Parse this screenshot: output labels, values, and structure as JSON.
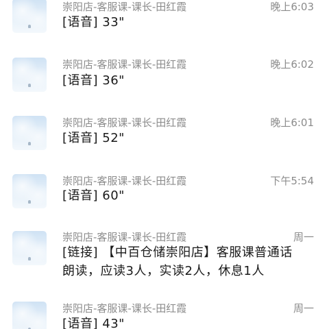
{
  "chats": [
    {
      "sender": "崇阳店-客服课-课长-田红霞",
      "time": "晚上6:03",
      "message": "[语音] 33\""
    },
    {
      "sender": "崇阳店-客服课-课长-田红霞",
      "time": "晚上6:02",
      "message": "[语音] 36\""
    },
    {
      "sender": "崇阳店-客服课-课长-田红霞",
      "time": "晚上6:01",
      "message": "[语音] 52\""
    },
    {
      "sender": "崇阳店-客服课-课长-田红霞",
      "time": "下午5:54",
      "message": "[语音] 60\""
    },
    {
      "sender": "崇阳店-客服课-课长-田红霞",
      "time": "周一",
      "message": "[链接] 【中百仓储崇阳店】客服课普通话",
      "message_line2": "朗读，应读3人，实读2人，休息1人"
    },
    {
      "sender": "崇阳店-客服课-课长-田红霞",
      "time": "周一",
      "message": "[语音] 43\""
    }
  ]
}
